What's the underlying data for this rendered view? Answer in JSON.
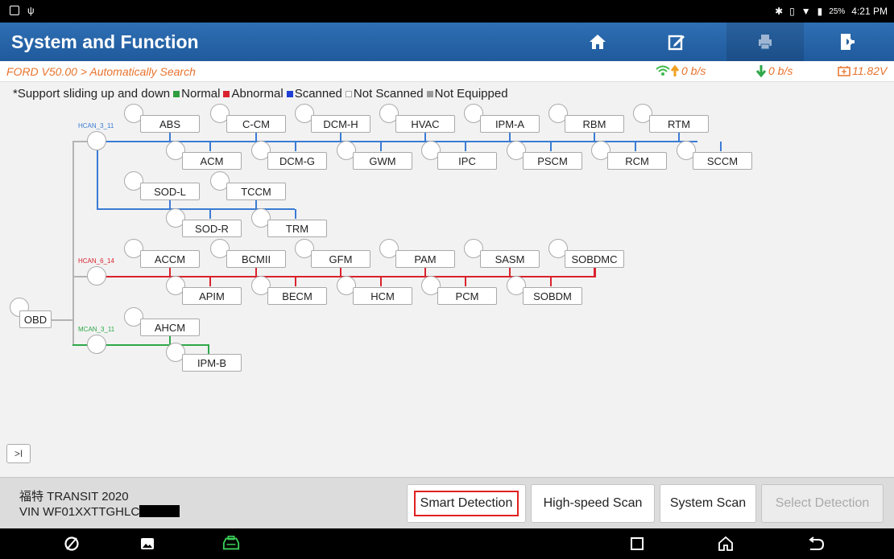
{
  "status_bar": {
    "time": "4:21 PM",
    "battery": "25%"
  },
  "header": {
    "title": "System and Function"
  },
  "breadcrumb": {
    "path": "FORD V50.00 > Automatically Search",
    "upload": "0 b/s",
    "download": "0 b/s",
    "voltage": "11.82V"
  },
  "legend": {
    "prefix": "*Support sliding up and down",
    "items": [
      {
        "label": "Normal",
        "color": "#2e9e3e"
      },
      {
        "label": "Abnormal",
        "color": "#d9232d"
      },
      {
        "label": "Scanned",
        "color": "#1f3fd6"
      },
      {
        "label": "Not Scanned",
        "color": "#ffffff"
      },
      {
        "label": "Not Equipped",
        "color": "#9a9a9a"
      }
    ]
  },
  "topology": {
    "root": "OBD",
    "buses": [
      {
        "name": "HCAN_3_11",
        "color": "#3a7bd5"
      },
      {
        "name": "HCAN_6_14",
        "color": "#d9232d"
      },
      {
        "name": "MCAN_3_11",
        "color": "#2ea84a"
      }
    ],
    "hcan3_top": [
      "ABS",
      "C-CM",
      "DCM-H",
      "HVAC",
      "IPM-A",
      "RBM",
      "RTM"
    ],
    "hcan3_bottom": [
      "ACM",
      "DCM-G",
      "GWM",
      "IPC",
      "PSCM",
      "RCM",
      "SCCM"
    ],
    "hcan3_sub_top": [
      "SOD-L",
      "TCCM"
    ],
    "hcan3_sub_bottom": [
      "SOD-R",
      "TRM"
    ],
    "hcan6_top": [
      "ACCM",
      "BCMII",
      "GFM",
      "PAM",
      "SASM",
      "SOBDMC"
    ],
    "hcan6_bottom": [
      "APIM",
      "BECM",
      "HCM",
      "PCM",
      "SOBDM"
    ],
    "mcan_top": [
      "AHCM"
    ],
    "mcan_bottom": [
      "IPM-B"
    ]
  },
  "collapse_label": ">I",
  "vehicle": {
    "name": "福特 TRANSIT 2020",
    "vin": "VIN WF01XXTTGHLC"
  },
  "buttons": {
    "smart": "Smart Detection",
    "highspeed": "High-speed Scan",
    "system": "System Scan",
    "select": "Select Detection"
  }
}
